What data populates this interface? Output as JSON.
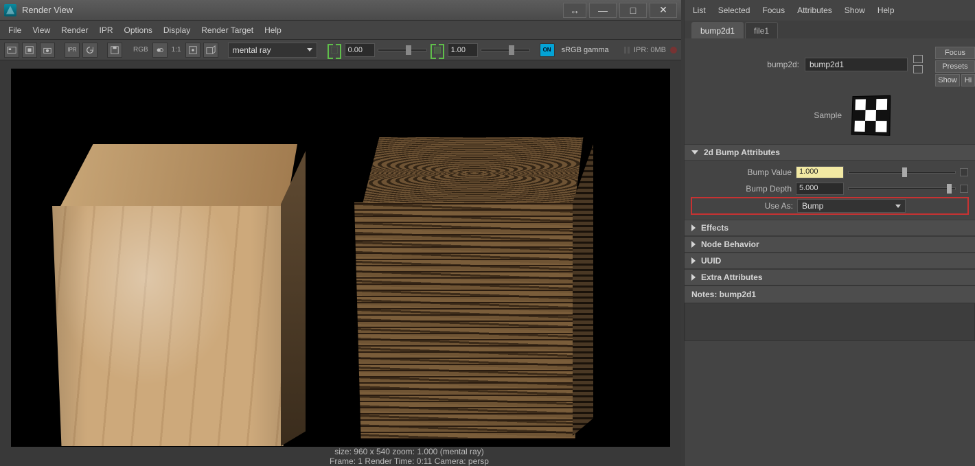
{
  "window": {
    "title": "Render View",
    "menus": [
      "File",
      "View",
      "Render",
      "IPR",
      "Options",
      "Display",
      "Render Target",
      "Help"
    ],
    "toolbar": {
      "renderer": "mental ray",
      "exposure_low": "0.00",
      "exposure_high": "1.00",
      "gamma_label": "sRGB gamma",
      "ratio_label": "1:1",
      "rgb_label": "RGB",
      "ipr_status": "IPR: 0MB"
    },
    "status": {
      "line1_left": "size: 960 x 540 zoom: 1.000",
      "line1_right": "(mental ray)",
      "line2_left": "Frame: 1",
      "line2_mid": "Render Time: 0:11",
      "line2_right": "Camera: persp"
    }
  },
  "attr": {
    "menus": [
      "List",
      "Selected",
      "Focus",
      "Attributes",
      "Show",
      "Help"
    ],
    "tabs": [
      {
        "label": "bump2d1",
        "active": true
      },
      {
        "label": "file1",
        "active": false
      }
    ],
    "header": {
      "type_label": "bump2d:",
      "name": "bump2d1",
      "buttons": {
        "focus": "Focus",
        "presets": "Presets",
        "show": "Show",
        "hide": "Hi"
      }
    },
    "sample_label": "Sample",
    "sections": {
      "bump": {
        "title": "2d Bump Attributes",
        "bump_value_label": "Bump Value",
        "bump_value": "1.000",
        "bump_depth_label": "Bump Depth",
        "bump_depth": "5.000",
        "use_as_label": "Use As:",
        "use_as_value": "Bump"
      },
      "effects": "Effects",
      "node_behavior": "Node Behavior",
      "uuid": "UUID",
      "extra": "Extra Attributes"
    },
    "notes_label": "Notes: bump2d1"
  }
}
